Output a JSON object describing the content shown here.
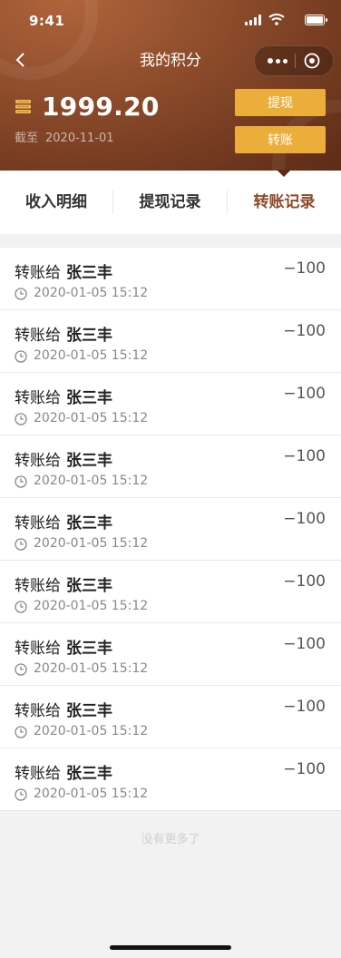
{
  "status_bar": {
    "time": "9:41"
  },
  "nav": {
    "title": "我的积分"
  },
  "points": {
    "value": "1999.20",
    "as_of_label": "截至",
    "as_of_date": "2020-11-01"
  },
  "actions": {
    "withdraw": "提现",
    "transfer": "转账"
  },
  "tabs": [
    {
      "label": "收入明细",
      "active": false
    },
    {
      "label": "提现记录",
      "active": false
    },
    {
      "label": "转账记录",
      "active": true
    }
  ],
  "records": [
    {
      "prefix": "转账给",
      "name": "张三丰",
      "amount": "−100",
      "time": "2020-01-05 15:12"
    },
    {
      "prefix": "转账给",
      "name": "张三丰",
      "amount": "−100",
      "time": "2020-01-05 15:12"
    },
    {
      "prefix": "转账给",
      "name": "张三丰",
      "amount": "−100",
      "time": "2020-01-05 15:12"
    },
    {
      "prefix": "转账给",
      "name": "张三丰",
      "amount": "−100",
      "time": "2020-01-05 15:12"
    },
    {
      "prefix": "转账给",
      "name": "张三丰",
      "amount": "−100",
      "time": "2020-01-05 15:12"
    },
    {
      "prefix": "转账给",
      "name": "张三丰",
      "amount": "−100",
      "time": "2020-01-05 15:12"
    },
    {
      "prefix": "转账给",
      "name": "张三丰",
      "amount": "−100",
      "time": "2020-01-05 15:12"
    },
    {
      "prefix": "转账给",
      "name": "张三丰",
      "amount": "−100",
      "time": "2020-01-05 15:12"
    },
    {
      "prefix": "转账给",
      "name": "张三丰",
      "amount": "−100",
      "time": "2020-01-05 15:12"
    }
  ],
  "footer": {
    "end_note": "没有更多了"
  },
  "colors": {
    "header_dark": "#5c2b17",
    "header_light": "#b0643b",
    "button": "#ecae3b",
    "active_tab": "#8e4a2b"
  },
  "icons": {
    "back": "chevron-left-icon",
    "more": "more-dots-icon",
    "close": "target-icon",
    "points": "coin-stack-icon",
    "time": "clock-icon"
  }
}
